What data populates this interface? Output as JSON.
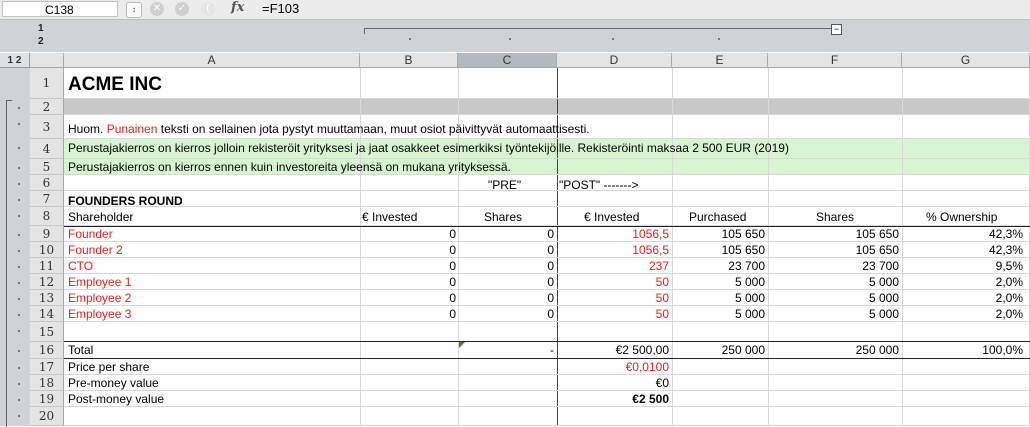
{
  "formula_bar": {
    "cell_ref": "C138",
    "stepper_icon": "up-down-stepper-icon",
    "cancel_icon": "cancel-icon",
    "accept_icon": "accept-icon",
    "fx_label": "fx",
    "formula": "=F103"
  },
  "outline": {
    "col_levels": [
      "1",
      "2"
    ],
    "row_levels": "1 2",
    "collapse_symbol": "−"
  },
  "columns": [
    "A",
    "B",
    "C",
    "D",
    "E",
    "F",
    "G"
  ],
  "selected_column": "C",
  "row_numbers": [
    "1",
    "2",
    "3",
    "4",
    "5",
    "6",
    "7",
    "8",
    "9",
    "10",
    "11",
    "12",
    "13",
    "14",
    "15",
    "16",
    "17",
    "18",
    "19",
    "20"
  ],
  "sheet": {
    "title": "ACME INC",
    "note_prefix": "Huom. ",
    "note_red_word": "Punainen",
    "note_suffix": " teksti on sellainen jota pystyt muuttamaan, muut osiot päivittyvät automaattisesti.",
    "info_line_1": "Perustajakierros on kierros jolloin rekisteröit yrityksesi ja jaat osakkeet esimerkiksi työntekijöille. Rekisteröinti maksaa 2 500 EUR (2019)",
    "info_line_2": "Perustajakierros on kierros ennen kuin investoreita yleensä on mukana yrityksessä.",
    "pre_label": "\"PRE\"",
    "post_label": "\"POST\"  ------->",
    "section_title": "FOUNDERS ROUND",
    "headers": [
      "Shareholder",
      "€ Invested",
      "Shares",
      "€ Invested",
      "Purchased",
      "Shares",
      "% Ownership"
    ],
    "rows": [
      [
        "Founder",
        "0",
        "0",
        "1056,5",
        "105 650",
        "105 650",
        "42,3%"
      ],
      [
        "Founder 2",
        "0",
        "0",
        "1056,5",
        "105 650",
        "105 650",
        "42,3%"
      ],
      [
        "CTO",
        "0",
        "0",
        "237",
        "23 700",
        "23 700",
        "9,5%"
      ],
      [
        "Employee 1",
        "0",
        "0",
        "50",
        "5 000",
        "5 000",
        "2,0%"
      ],
      [
        "Employee 2",
        "0",
        "0",
        "50",
        "5 000",
        "5 000",
        "2,0%"
      ],
      [
        "Employee 3",
        "0",
        "0",
        "50",
        "5 000",
        "5 000",
        "2,0%"
      ]
    ],
    "total": [
      "Total",
      "",
      "-",
      "€2 500,00",
      "250 000",
      "250 000",
      "100,0%"
    ],
    "price_label": "Price per share",
    "price_value": "€0,0100",
    "premoney_label": "Pre-money value",
    "premoney_value": "€0",
    "postmoney_label": "Post-money value",
    "postmoney_value": "€2 500"
  },
  "colors": {
    "editable_red": "#e0231c",
    "green_band": "#d6f5d0",
    "grey_band": "#c8c8c8",
    "selected_header": "#b4b9c0"
  }
}
